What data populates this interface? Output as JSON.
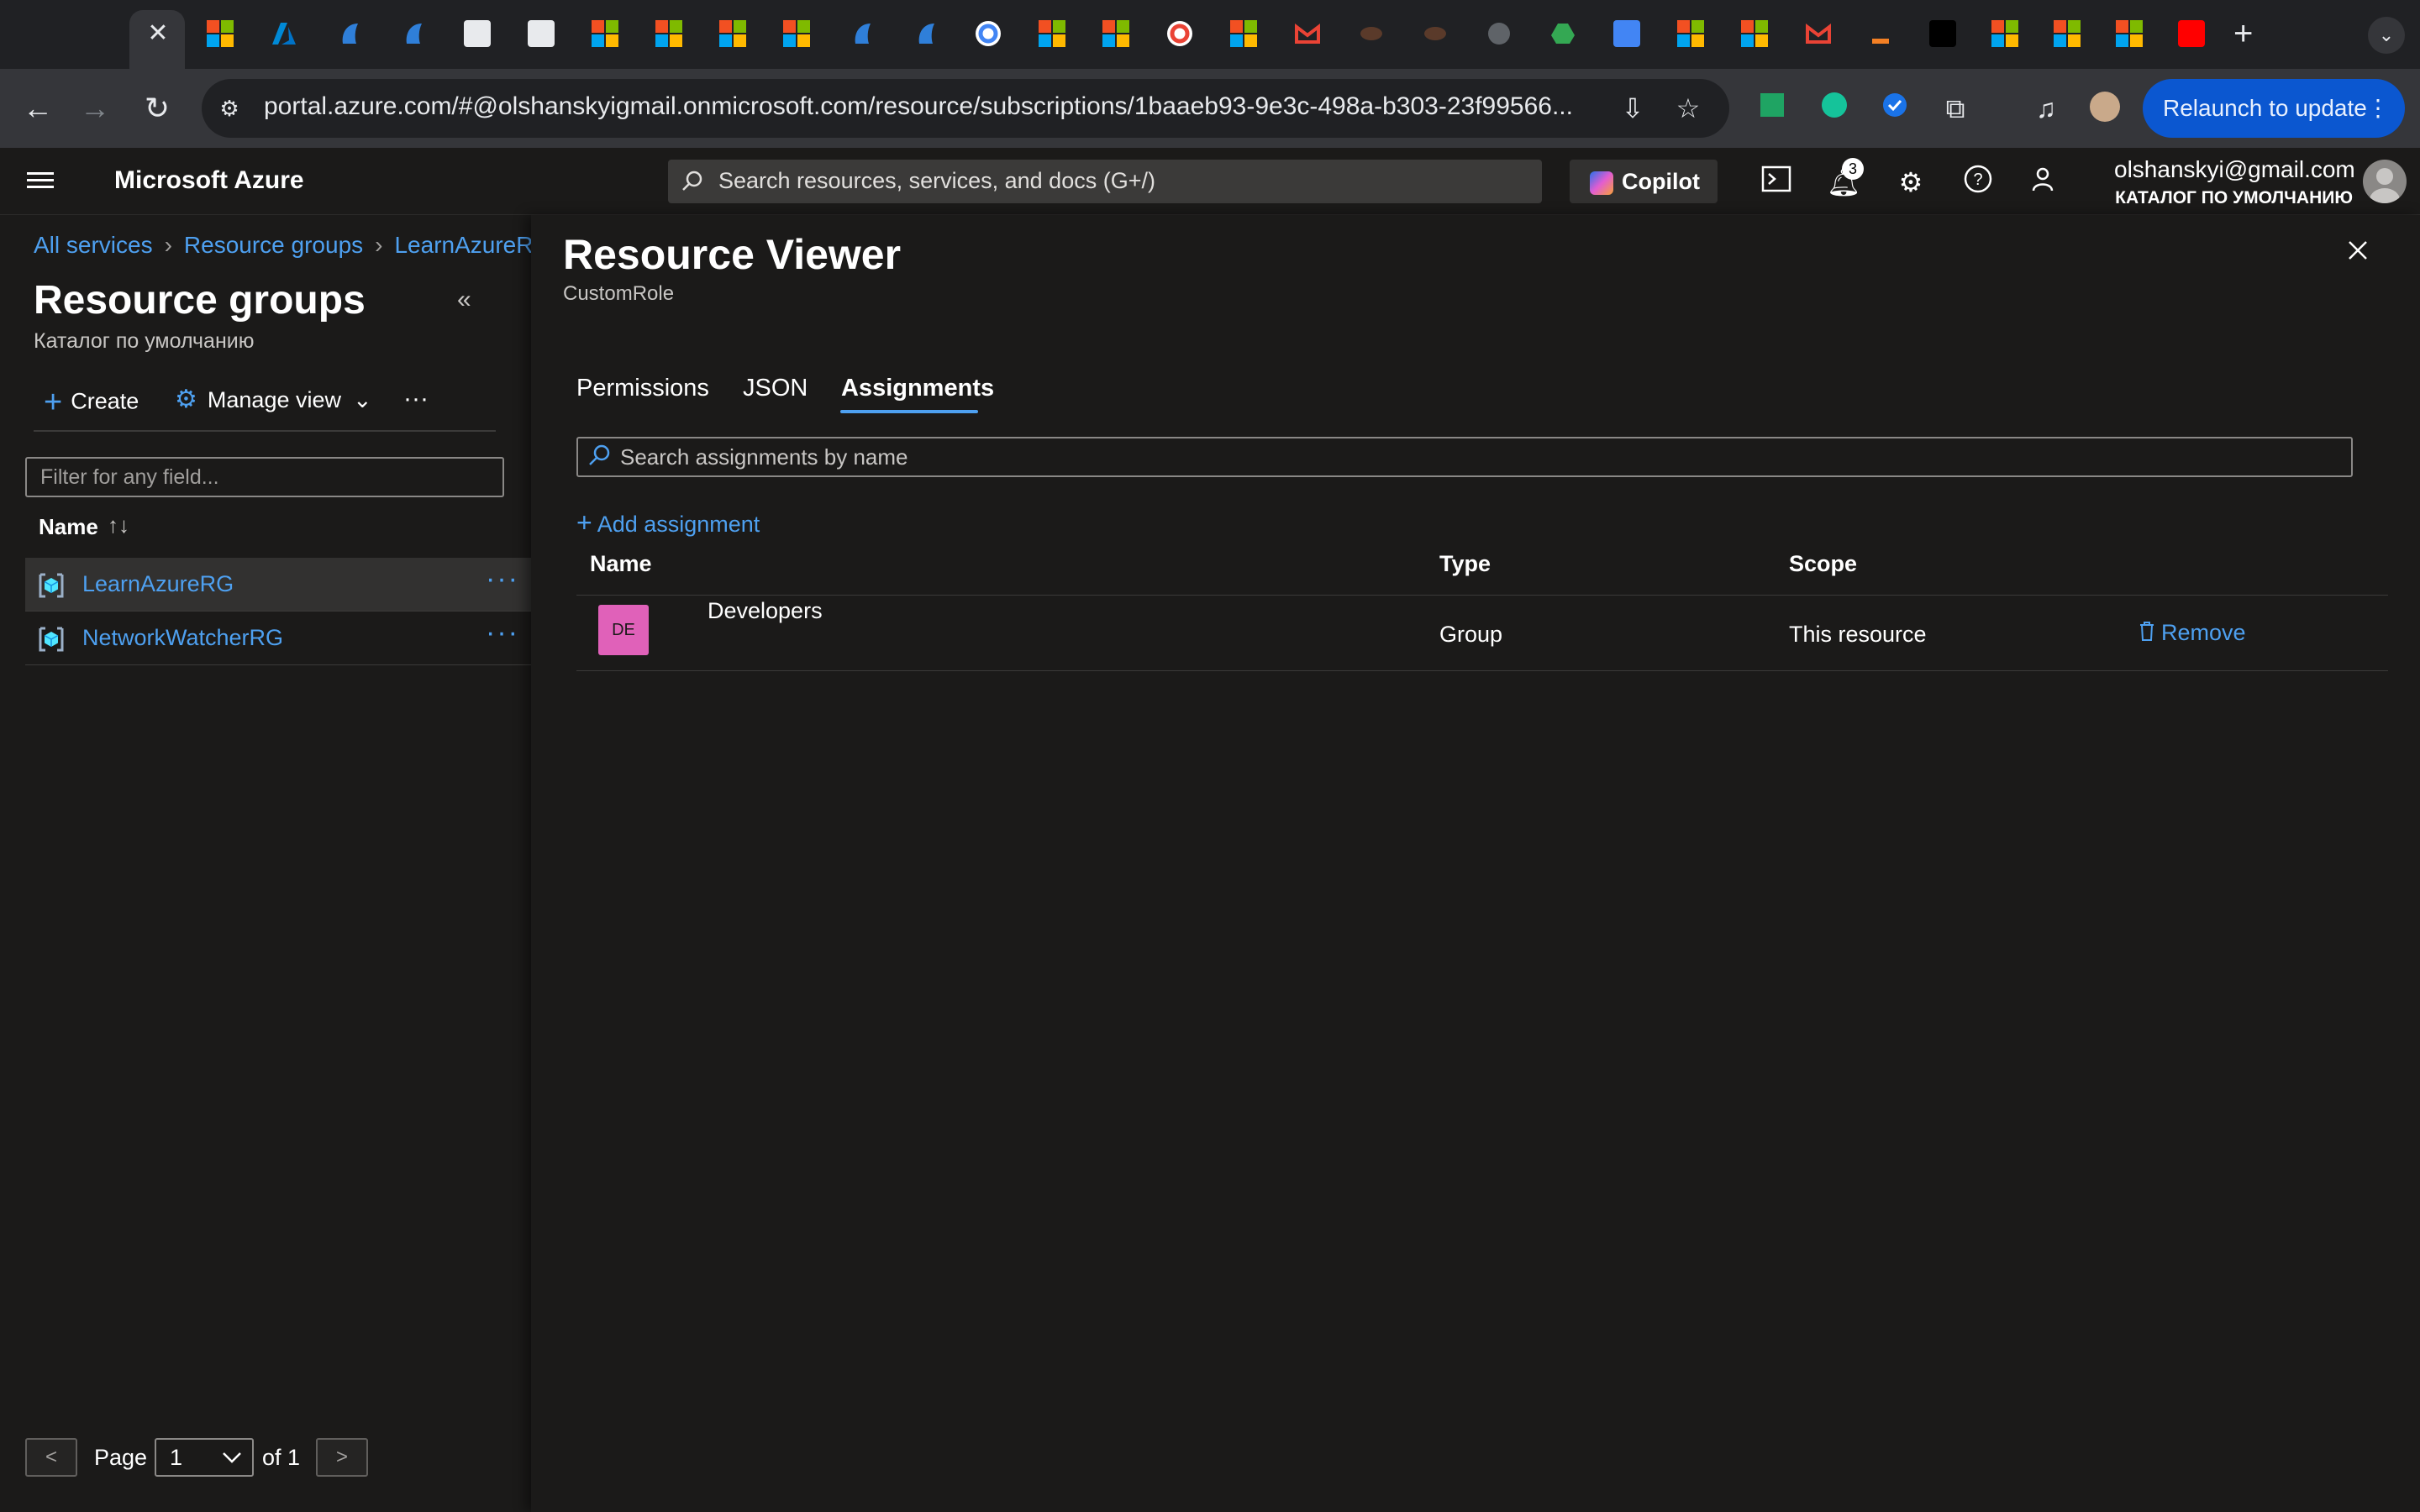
{
  "browser": {
    "active_tab_close": "✕",
    "url": "portal.azure.com/#@olshanskyigmail.onmicrosoft.com/resource/subscriptions/1baaeb93-9e3c-498a-b303-23f99566...",
    "relaunch_label": "Relaunch to update"
  },
  "header": {
    "brand": "Microsoft Azure",
    "search_placeholder": "Search resources, services, and docs (G+/)",
    "copilot_label": "Copilot",
    "notifications_count": "3",
    "user_email": "olshanskyi@gmail.com",
    "user_directory": "КАТАЛОГ ПО УМОЛЧАНИЮ"
  },
  "breadcrumb": {
    "items": [
      "All services",
      "Resource groups",
      "LearnAzureRG"
    ]
  },
  "left": {
    "title": "Resource groups",
    "subtitle": "Каталог по умолчанию",
    "commands": {
      "create": "Create",
      "manage_view": "Manage view",
      "more": "···"
    },
    "filter_placeholder": "Filter for any field...",
    "column_name": "Name",
    "rows": [
      {
        "name": "LearnAzureRG",
        "selected": true
      },
      {
        "name": "NetworkWatcherRG",
        "selected": false
      }
    ],
    "pager": {
      "prev": "<",
      "label": "Page",
      "value": "1",
      "of": "of 1",
      "next": ">"
    }
  },
  "viewer": {
    "title": "Resource Viewer",
    "subtitle": "CustomRole",
    "tabs": [
      "Permissions",
      "JSON",
      "Assignments"
    ],
    "active_tab": "Assignments",
    "search_placeholder": "Search assignments by name",
    "add_label": "Add assignment",
    "columns": [
      "Name",
      "Type",
      "Scope"
    ],
    "rows": [
      {
        "initials": "DE",
        "name": "Developers",
        "type": "Group",
        "scope": "This resource",
        "action": "Remove"
      }
    ]
  },
  "colors": {
    "accent": "#4ea0f0",
    "avatar": "#e061b9",
    "relaunch": "#0b57d0"
  }
}
